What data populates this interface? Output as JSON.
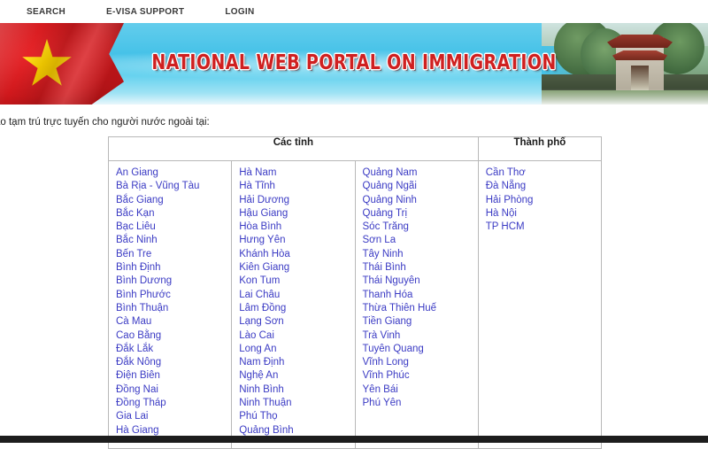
{
  "nav": {
    "items": [
      {
        "label": "SEARCH",
        "name": "nav-search"
      },
      {
        "label": "E-VISA SUPPORT",
        "name": "nav-evisa-support"
      },
      {
        "label": "LOGIN",
        "name": "nav-login"
      }
    ]
  },
  "banner": {
    "title": "NATIONAL WEB PORTAL ON IMMIGRATION",
    "flag_alt": "vietnam-flag",
    "photo_alt": "temple-of-literature-gate"
  },
  "intro": {
    "text": "áo tạm trú trực tuyến cho người nước ngoài tại:"
  },
  "table": {
    "headers": {
      "provinces": "Các tỉnh",
      "cities": "Thành phố"
    },
    "columns": [
      {
        "key": "col1",
        "items": [
          "An Giang",
          "Bà Rịa - Vũng Tàu",
          "Bắc Giang",
          "Bắc Kạn",
          "Bạc Liêu",
          "Bắc Ninh",
          "Bến Tre",
          "Bình Định",
          "Bình Dương",
          "Bình Phước",
          "Bình Thuận",
          "Cà Mau",
          "Cao Bằng",
          "Đắk Lắk",
          "Đắk Nông",
          "Điện Biên",
          "Đồng Nai",
          "Đồng Tháp",
          "Gia Lai",
          "Hà Giang"
        ]
      },
      {
        "key": "col2",
        "items": [
          "Hà Nam",
          "Hà Tĩnh",
          "Hải Dương",
          "Hậu Giang",
          "Hòa Bình",
          "Hưng Yên",
          "Khánh Hòa",
          "Kiên Giang",
          "Kon Tum",
          "Lai Châu",
          "Lâm Đồng",
          "Lạng Sơn",
          "Lào Cai",
          "Long An",
          "Nam Định",
          "Nghệ An",
          "Ninh Bình",
          "Ninh Thuận",
          "Phú Thọ",
          "Quảng Bình"
        ]
      },
      {
        "key": "col3",
        "items": [
          "Quảng Nam",
          "Quảng Ngãi",
          "Quảng Ninh",
          "Quảng Trị",
          "Sóc Trăng",
          "Sơn La",
          "Tây Ninh",
          "Thái Bình",
          "Thái Nguyên",
          "Thanh Hóa",
          "Thừa Thiên Huế",
          "Tiền Giang",
          "Trà Vinh",
          "Tuyên Quang",
          "Vĩnh Long",
          "Vĩnh Phúc",
          "Yên Bái",
          "Phú Yên"
        ]
      },
      {
        "key": "col4",
        "items": [
          "Cần Thơ",
          "Đà Nẵng",
          "Hải Phòng",
          "Hà Nội",
          "TP HCM"
        ]
      }
    ]
  },
  "colors": {
    "link": "#3b3bc4",
    "banner_blue": "#46c2e8",
    "title_red": "#cf2020",
    "flag_red": "#d0181c",
    "star_yellow": "#ffd400",
    "border": "#b8b8b8"
  }
}
